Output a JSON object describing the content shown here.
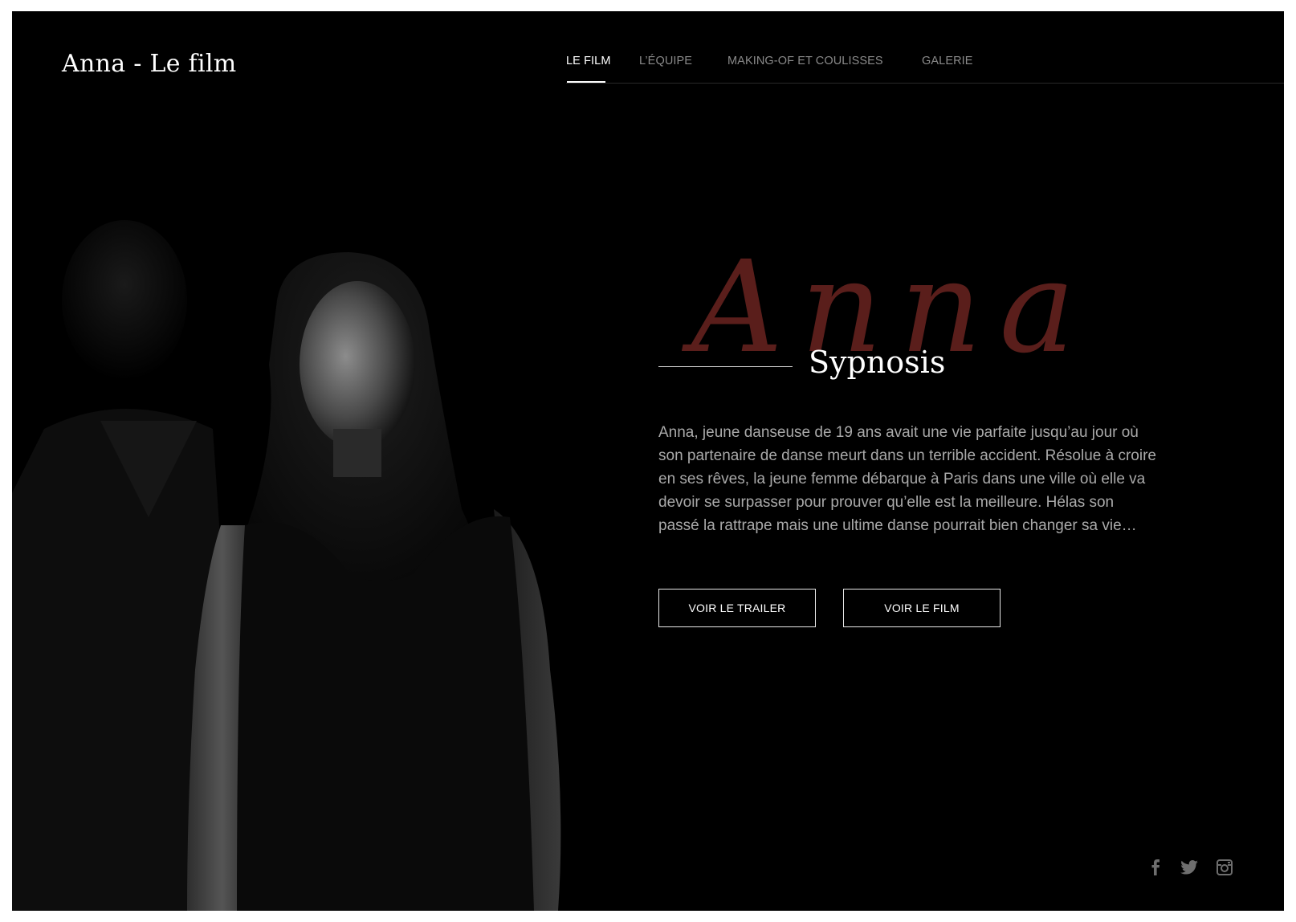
{
  "brand": {
    "title": "Anna - Le film"
  },
  "nav": {
    "items": [
      {
        "label": "LE FILM",
        "active": true
      },
      {
        "label": "L’ÉQUIPE",
        "active": false
      },
      {
        "label": "MAKING-OF ET COULISSES",
        "active": false
      },
      {
        "label": "GALERIE",
        "active": false
      }
    ]
  },
  "hero": {
    "watermark": "Anna",
    "section_title": "Sypnosis",
    "synopsis": "Anna, jeune danseuse de 19 ans avait une vie parfaite jusqu’au jour où son partenaire de danse meurt dans un terrible accident. Résolue à croire en ses rêves, la jeune femme débarque à Paris dans une ville où elle va devoir se surpasser pour prouver qu’elle est la meilleure. Hélas son passé la rattrape mais une ultime danse pourrait bien changer sa vie…",
    "buttons": {
      "trailer": "VOIR LE TRAILER",
      "film": "VOIR LE FILM"
    }
  },
  "social": {
    "icons": [
      "facebook-icon",
      "twitter-icon",
      "instagram-icon"
    ]
  },
  "colors": {
    "background": "#000000",
    "watermark": "#5a1e1b",
    "nav_inactive": "#8a8a8a",
    "text": "#a9a9a9"
  }
}
